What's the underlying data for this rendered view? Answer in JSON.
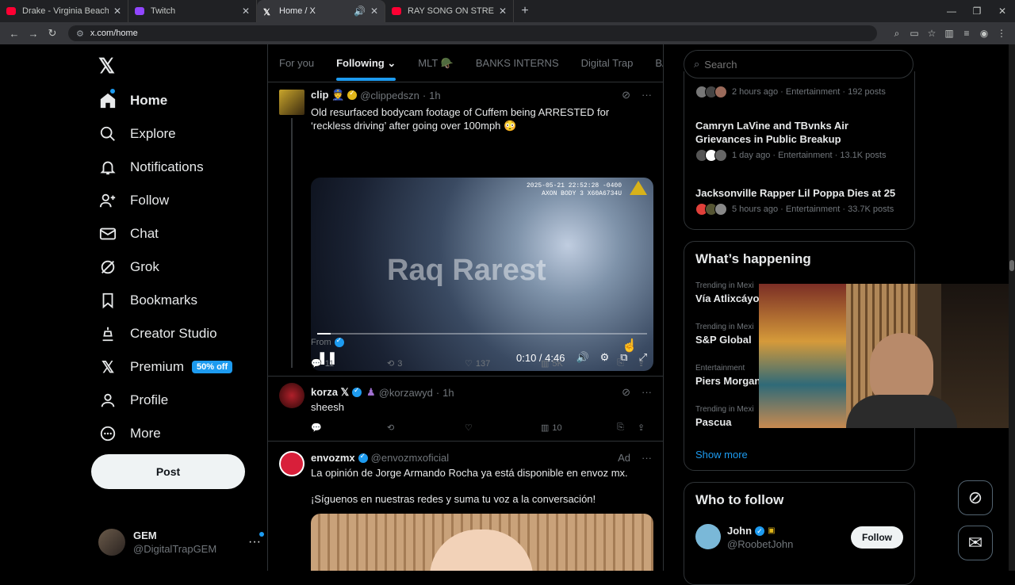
{
  "browser": {
    "tabs": [
      {
        "title": "Drake - Virginia Beach (Audio)",
        "color": "#ff0033"
      },
      {
        "title": "Twitch",
        "color": "#9146ff"
      },
      {
        "title": "Home / X",
        "color": "#ffffff"
      },
      {
        "title": "RAY SONG ON STREAM CHRIS",
        "color": "#ff0033"
      }
    ],
    "url": "x.com/home"
  },
  "sidebar": {
    "items": [
      {
        "label": "Home",
        "icon": "home-icon"
      },
      {
        "label": "Explore",
        "icon": "search-icon"
      },
      {
        "label": "Notifications",
        "icon": "bell-icon"
      },
      {
        "label": "Follow",
        "icon": "person-plus-icon"
      },
      {
        "label": "Chat",
        "icon": "mail-icon"
      },
      {
        "label": "Grok",
        "icon": "grok-icon"
      },
      {
        "label": "Bookmarks",
        "icon": "bookmark-icon"
      },
      {
        "label": "Creator Studio",
        "icon": "creator-icon"
      },
      {
        "label": "Premium",
        "icon": "x-icon"
      },
      {
        "label": "Profile",
        "icon": "person-icon"
      },
      {
        "label": "More",
        "icon": "more-circle-icon"
      }
    ],
    "premium_badge": "50% off",
    "post_label": "Post",
    "account": {
      "name": "GEM",
      "handle": "@DigitalTrapGEM"
    }
  },
  "feed": {
    "tabs": [
      "For you",
      "Following",
      "MLT 🪖",
      "BANKS INTERNS",
      "Digital Trap",
      "BAU"
    ],
    "tweets": [
      {
        "name": "clip 👮",
        "handle": "@clippedszn",
        "time": "1h",
        "text": "Old resurfaced bodycam footage of Cuffem being ARRESTED for ‘reckless driving’ after going over 100mph 😳",
        "video": {
          "stamp": "2025-05-21 22:52:28 -0400",
          "device": "AXON BODY 3 X60A6734U",
          "watermark": "Raq Rarest",
          "time": "0:10 / 4:46",
          "progress": 0.04
        },
        "from_label": "From",
        "replies": "11",
        "reposts": "3",
        "likes": "137",
        "views": "5K"
      },
      {
        "name": "korza 𝕏",
        "handle": "@korzawyd",
        "time": "1h",
        "text": "sheesh",
        "replies": "",
        "reposts": "",
        "likes": "",
        "views": "10"
      },
      {
        "name": "envozmx",
        "handle": "@envozmxoficial",
        "ad": "Ad",
        "text": "La opinión de Jorge Armando Rocha ya está disponible en envoz mx.",
        "text2": "¡Síguenos en nuestras redes y suma tu voz a la conversación!"
      }
    ]
  },
  "right": {
    "search_placeholder": "Search",
    "trends": [
      {
        "title": "",
        "meta": "2 hours ago · Entertainment · 192 posts"
      },
      {
        "title": "Camryn LaVine and TBvnks Air Grievances in Public Breakup",
        "meta": "1 day ago · Entertainment · 13.1K posts"
      },
      {
        "title": "Jacksonville Rapper Lil Poppa Dies at 25",
        "meta": "5 hours ago · Entertainment · 33.7K posts"
      }
    ],
    "whats_happening": {
      "title": "What’s happening",
      "items": [
        {
          "context": "Trending in Mexi",
          "title": "Vía Atlixcáyot"
        },
        {
          "context": "Trending in Mexi",
          "title": "S&P Global"
        },
        {
          "context": "Entertainment",
          "title": "Piers Morgan"
        },
        {
          "context": "Trending in Mexi",
          "title": "Pascua"
        }
      ],
      "show_more": "Show more"
    },
    "who_to_follow": {
      "title": "Who to follow",
      "user": {
        "name": "John",
        "handle": "@RoobetJohn"
      },
      "follow_label": "Follow"
    }
  }
}
